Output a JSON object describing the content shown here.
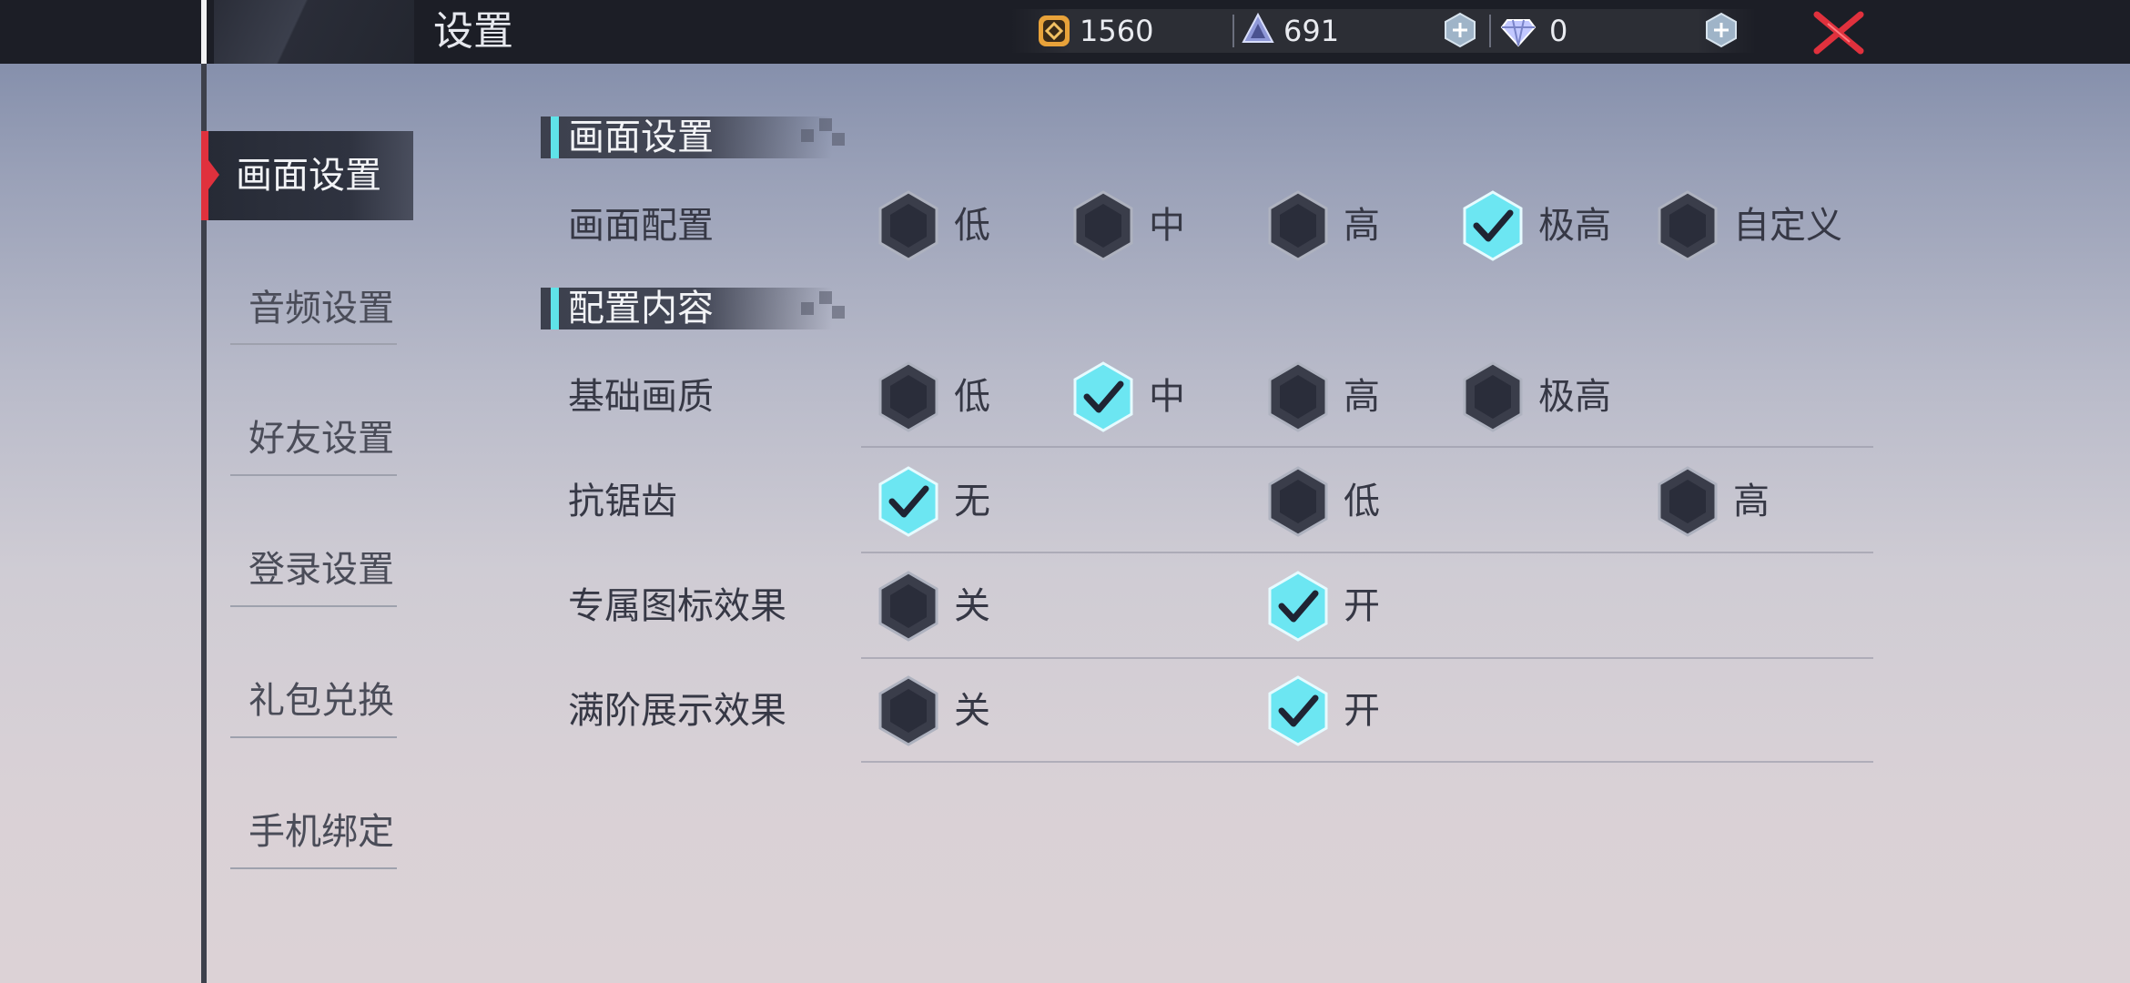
{
  "header": {
    "title": "设置",
    "currencies": [
      {
        "icon": "gold-coin-icon",
        "value": "1560"
      },
      {
        "icon": "stamina-crystal-icon",
        "value": "691"
      },
      {
        "icon": "diamond-icon",
        "value": "0"
      }
    ]
  },
  "sidebar": {
    "items": [
      {
        "label": "画面设置",
        "active": true
      },
      {
        "label": "音频设置"
      },
      {
        "label": "好友设置"
      },
      {
        "label": "登录设置"
      },
      {
        "label": "礼包兑换"
      },
      {
        "label": "手机绑定"
      }
    ]
  },
  "sections": [
    {
      "title": "画面设置"
    },
    {
      "title": "配置内容"
    }
  ],
  "rows": [
    {
      "label": "画面配置",
      "options": [
        {
          "label": "低",
          "checked": false
        },
        {
          "label": "中",
          "checked": false
        },
        {
          "label": "高",
          "checked": false
        },
        {
          "label": "极高",
          "checked": true
        },
        {
          "label": "自定义",
          "checked": false
        }
      ]
    },
    {
      "label": "基础画质",
      "options": [
        {
          "label": "低",
          "checked": false
        },
        {
          "label": "中",
          "checked": true
        },
        {
          "label": "高",
          "checked": false
        },
        {
          "label": "极高",
          "checked": false
        }
      ]
    },
    {
      "label": "抗锯齿",
      "options": [
        {
          "label": "无",
          "checked": true
        },
        {
          "label": "低",
          "checked": false
        },
        {
          "label": "高",
          "checked": false
        }
      ]
    },
    {
      "label": "专属图标效果",
      "options": [
        {
          "label": "关",
          "checked": false
        },
        {
          "label": "开",
          "checked": true
        }
      ]
    },
    {
      "label": "满阶展示效果",
      "options": [
        {
          "label": "关",
          "checked": false
        },
        {
          "label": "开",
          "checked": true
        }
      ]
    }
  ],
  "colors": {
    "accent": "#5fe3e8",
    "checked_fill": "#6ce6f2",
    "unchecked_fill": "#2a2d3a",
    "close_red": "#e0313d"
  }
}
